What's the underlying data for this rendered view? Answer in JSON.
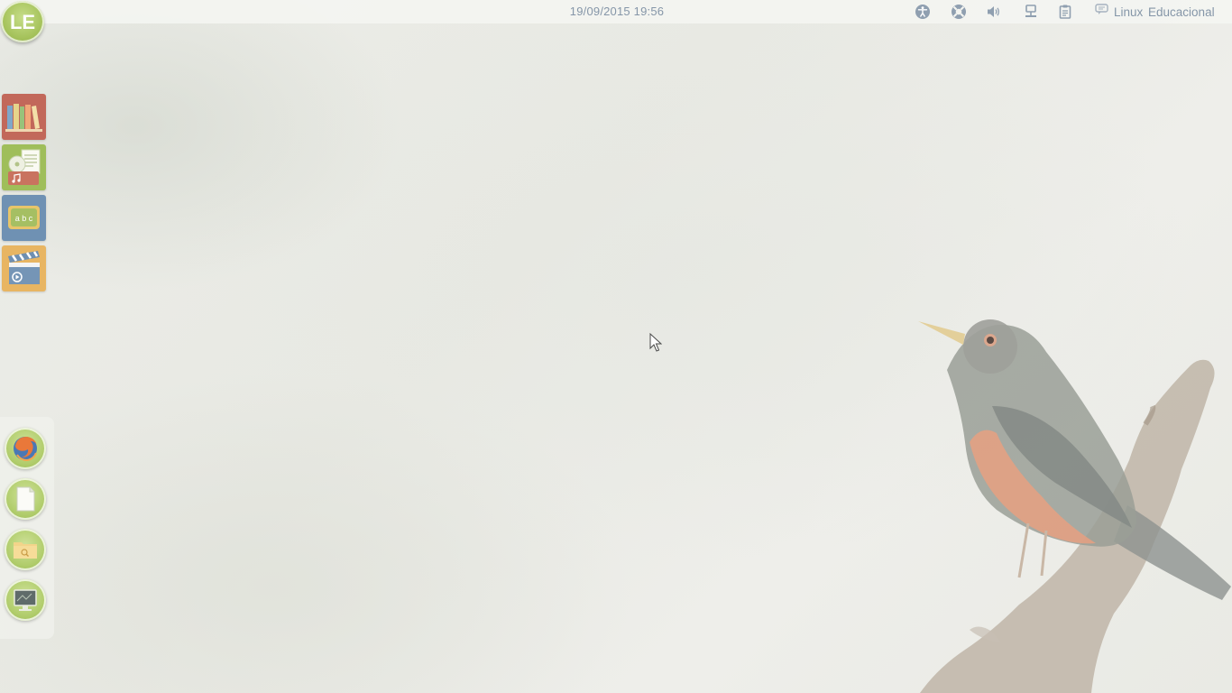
{
  "top_panel": {
    "clock": "19/09/2015  19:56",
    "tray": {
      "icons": [
        "accessibility-icon",
        "help-lifebuoy-icon",
        "volume-icon",
        "network-icon",
        "clipboard-icon"
      ]
    },
    "brand": {
      "icon": "chat-bubble-icon",
      "label": "Linux  Educacional"
    }
  },
  "logo": {
    "text": "LE"
  },
  "launcher": {
    "items": [
      {
        "icon": "bookshelf-icon",
        "color": "#c2685a"
      },
      {
        "icon": "media-documents-icon",
        "color": "#9fbe5a"
      },
      {
        "icon": "abc-board-icon",
        "color": "#6f91b3"
      },
      {
        "icon": "clapperboard-icon",
        "color": "#e8b562"
      }
    ]
  },
  "dock": {
    "items": [
      {
        "icon": "firefox-icon"
      },
      {
        "icon": "document-icon"
      },
      {
        "icon": "folder-search-icon"
      },
      {
        "icon": "monitor-icon"
      }
    ]
  },
  "colors": {
    "panel_text": "#8596a8",
    "accent_green": "#a6c35c"
  }
}
